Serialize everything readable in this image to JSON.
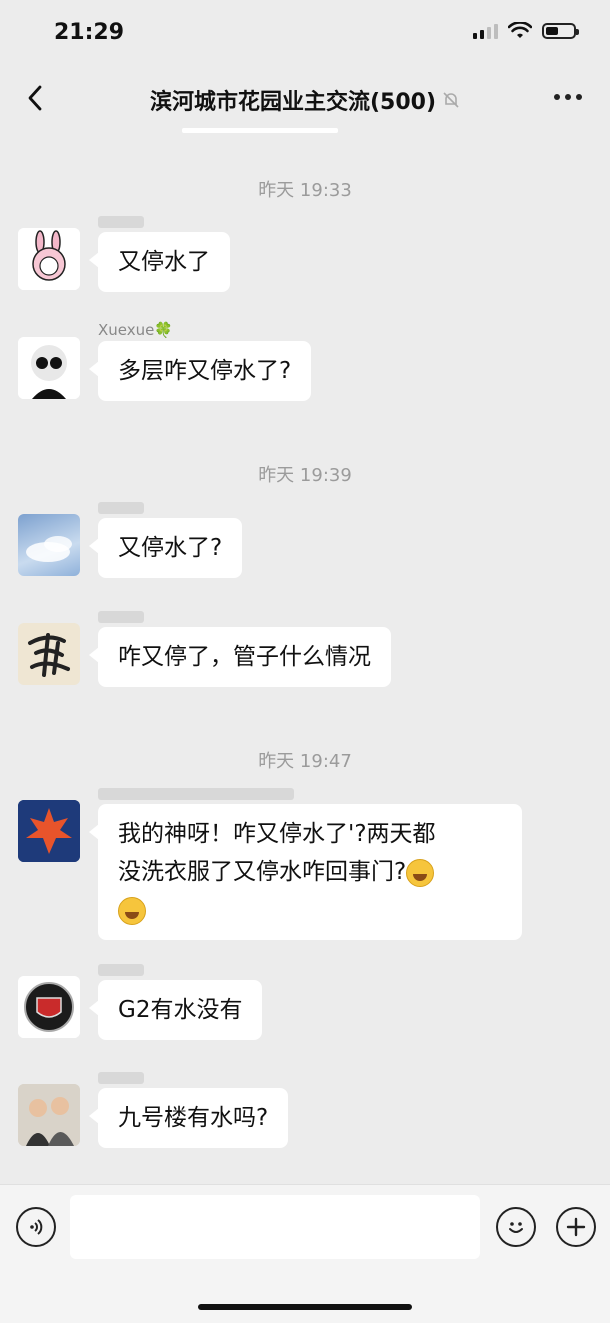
{
  "status_bar": {
    "time": "21:29"
  },
  "header": {
    "title": "滨河城市花园业主交流(500)"
  },
  "timestamps": [
    "昨天 19:33",
    "昨天 19:39",
    "昨天 19:47"
  ],
  "messages": [
    {
      "sender": "",
      "text": "又停水了"
    },
    {
      "sender": "Xuexue🍀",
      "text": "多层咋又停水了?"
    },
    {
      "sender": "",
      "text": "又停水了?"
    },
    {
      "sender": "",
      "text": "咋又停了，管子什么情况"
    },
    {
      "sender": "",
      "text_line1": "我的神呀！咋又停水了'?两天都",
      "text_line2": "没洗衣服了又停水咋回事门?",
      "text_line3": ""
    },
    {
      "sender": "",
      "text": "G2有水没有"
    },
    {
      "sender": "",
      "text": "九号楼有水吗?"
    }
  ],
  "input": {
    "placeholder": ""
  },
  "icons": {
    "back": "chevron-left-icon",
    "mute": "bell-mute-icon",
    "more": "more-dots-icon",
    "voice": "voice-icon",
    "emoji": "emoji-icon",
    "plus": "plus-icon"
  }
}
